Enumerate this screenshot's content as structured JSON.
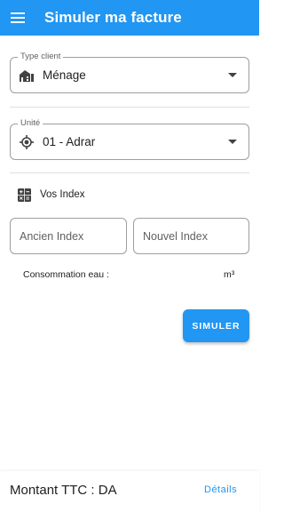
{
  "appbar": {
    "title": "Simuler ma facture",
    "menu_icon": "menu-icon",
    "color": "#2196f3"
  },
  "type_client": {
    "label": "Type client",
    "value": "Ménage",
    "icon": "house-icon"
  },
  "unite": {
    "label": "Unité",
    "value": "01 - Adrar",
    "icon": "gps-target-icon"
  },
  "index": {
    "header": "Vos Index",
    "icon": "calculator-icon",
    "ancien_placeholder": "Ancien Index",
    "nouvel_placeholder": "Nouvel Index"
  },
  "consommation": {
    "label": "Consommation eau :",
    "unit": "m³"
  },
  "actions": {
    "simuler_label": "SIMULER"
  },
  "footer": {
    "total_label": "Montant TTC : DA",
    "details_label": "Détails"
  },
  "colors": {
    "accent": "#2196f3",
    "outline": "#9e9e9e",
    "text": "#212121"
  }
}
